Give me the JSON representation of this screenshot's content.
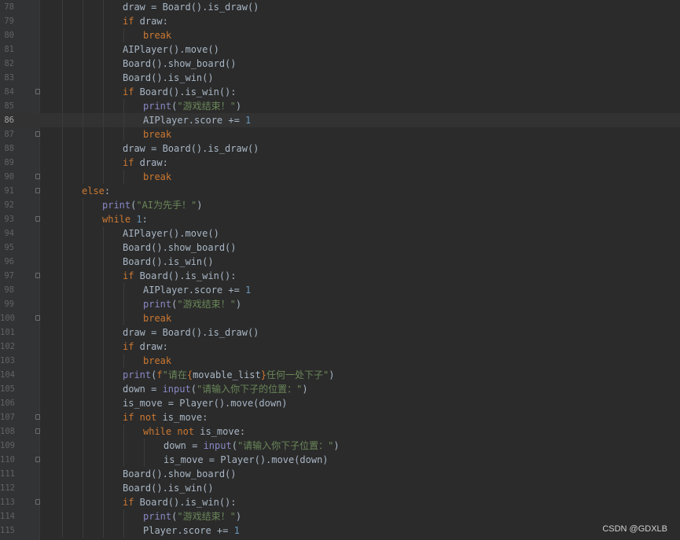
{
  "editor": {
    "current_line": 86,
    "lines": [
      {
        "n": "78",
        "indent": 4,
        "fold": false,
        "tokens": [
          {
            "t": "draw = Board().is_draw()",
            "c": "pl"
          }
        ]
      },
      {
        "n": "79",
        "indent": 4,
        "fold": false,
        "tokens": [
          {
            "t": "if",
            "c": "kw"
          },
          {
            "t": " draw:",
            "c": "pl"
          }
        ]
      },
      {
        "n": "80",
        "indent": 5,
        "fold": false,
        "tokens": [
          {
            "t": "break",
            "c": "kw"
          }
        ]
      },
      {
        "n": "81",
        "indent": 4,
        "fold": false,
        "tokens": [
          {
            "t": "AIPlayer().move()",
            "c": "pl"
          }
        ]
      },
      {
        "n": "82",
        "indent": 4,
        "fold": false,
        "tokens": [
          {
            "t": "Board().show_board()",
            "c": "pl"
          }
        ]
      },
      {
        "n": "83",
        "indent": 4,
        "fold": false,
        "tokens": [
          {
            "t": "Board().is_win()",
            "c": "pl"
          }
        ]
      },
      {
        "n": "84",
        "indent": 4,
        "fold": true,
        "tokens": [
          {
            "t": "if",
            "c": "kw"
          },
          {
            "t": " Board().is_win():",
            "c": "pl"
          }
        ]
      },
      {
        "n": "85",
        "indent": 5,
        "fold": false,
        "tokens": [
          {
            "t": "print",
            "c": "bi"
          },
          {
            "t": "(",
            "c": "pl"
          },
          {
            "t": "\"游戏结束！\"",
            "c": "str"
          },
          {
            "t": ")",
            "c": "pl"
          }
        ]
      },
      {
        "n": "86",
        "indent": 5,
        "fold": false,
        "tokens": [
          {
            "t": "AIPlayer.score += ",
            "c": "pl"
          },
          {
            "t": "1",
            "c": "num"
          }
        ]
      },
      {
        "n": "87",
        "indent": 5,
        "fold": true,
        "tokens": [
          {
            "t": "break",
            "c": "kw"
          }
        ]
      },
      {
        "n": "88",
        "indent": 4,
        "fold": false,
        "tokens": [
          {
            "t": "draw = Board().is_draw()",
            "c": "pl"
          }
        ]
      },
      {
        "n": "89",
        "indent": 4,
        "fold": false,
        "tokens": [
          {
            "t": "if",
            "c": "kw"
          },
          {
            "t": " draw:",
            "c": "pl"
          }
        ]
      },
      {
        "n": "90",
        "indent": 5,
        "fold": true,
        "tokens": [
          {
            "t": "break",
            "c": "kw"
          }
        ]
      },
      {
        "n": "91",
        "indent": 2,
        "fold": true,
        "tokens": [
          {
            "t": "else",
            "c": "kw"
          },
          {
            "t": ":",
            "c": "pl"
          }
        ]
      },
      {
        "n": "92",
        "indent": 3,
        "fold": false,
        "tokens": [
          {
            "t": "print",
            "c": "bi"
          },
          {
            "t": "(",
            "c": "pl"
          },
          {
            "t": "\"AI为先手！\"",
            "c": "str"
          },
          {
            "t": ")",
            "c": "pl"
          }
        ]
      },
      {
        "n": "93",
        "indent": 3,
        "fold": true,
        "tokens": [
          {
            "t": "while",
            "c": "kw"
          },
          {
            "t": " ",
            "c": "pl"
          },
          {
            "t": "1",
            "c": "num"
          },
          {
            "t": ":",
            "c": "pl"
          }
        ]
      },
      {
        "n": "94",
        "indent": 4,
        "fold": false,
        "tokens": [
          {
            "t": "AIPlayer().move()",
            "c": "pl"
          }
        ]
      },
      {
        "n": "95",
        "indent": 4,
        "fold": false,
        "tokens": [
          {
            "t": "Board().show_board()",
            "c": "pl"
          }
        ]
      },
      {
        "n": "96",
        "indent": 4,
        "fold": false,
        "tokens": [
          {
            "t": "Board().is_win()",
            "c": "pl"
          }
        ]
      },
      {
        "n": "97",
        "indent": 4,
        "fold": true,
        "tokens": [
          {
            "t": "if",
            "c": "kw"
          },
          {
            "t": " Board().is_win():",
            "c": "pl"
          }
        ]
      },
      {
        "n": "98",
        "indent": 5,
        "fold": false,
        "tokens": [
          {
            "t": "AIPlayer.score += ",
            "c": "pl"
          },
          {
            "t": "1",
            "c": "num"
          }
        ]
      },
      {
        "n": "99",
        "indent": 5,
        "fold": false,
        "tokens": [
          {
            "t": "print",
            "c": "bi"
          },
          {
            "t": "(",
            "c": "pl"
          },
          {
            "t": "\"游戏结束！\"",
            "c": "str"
          },
          {
            "t": ")",
            "c": "pl"
          }
        ]
      },
      {
        "n": "100",
        "indent": 5,
        "fold": true,
        "tokens": [
          {
            "t": "break",
            "c": "kw"
          }
        ]
      },
      {
        "n": "101",
        "indent": 4,
        "fold": false,
        "tokens": [
          {
            "t": "draw = Board().is_draw()",
            "c": "pl"
          }
        ]
      },
      {
        "n": "102",
        "indent": 4,
        "fold": false,
        "tokens": [
          {
            "t": "if",
            "c": "kw"
          },
          {
            "t": " draw:",
            "c": "pl"
          }
        ]
      },
      {
        "n": "103",
        "indent": 5,
        "fold": false,
        "tokens": [
          {
            "t": "break",
            "c": "kw"
          }
        ]
      },
      {
        "n": "104",
        "indent": 4,
        "fold": false,
        "tokens": [
          {
            "t": "print",
            "c": "bi"
          },
          {
            "t": "(",
            "c": "pl"
          },
          {
            "t": "f",
            "c": "fp"
          },
          {
            "t": "\"请在",
            "c": "str"
          },
          {
            "t": "{",
            "c": "fp"
          },
          {
            "t": "movable_list",
            "c": "pl"
          },
          {
            "t": "}",
            "c": "fp"
          },
          {
            "t": "任何一处下子\"",
            "c": "str"
          },
          {
            "t": ")",
            "c": "pl"
          }
        ]
      },
      {
        "n": "105",
        "indent": 4,
        "fold": false,
        "tokens": [
          {
            "t": "down = ",
            "c": "pl"
          },
          {
            "t": "input",
            "c": "bi"
          },
          {
            "t": "(",
            "c": "pl"
          },
          {
            "t": "\"请输入你下子的位置：\"",
            "c": "str"
          },
          {
            "t": ")",
            "c": "pl"
          }
        ]
      },
      {
        "n": "106",
        "indent": 4,
        "fold": false,
        "tokens": [
          {
            "t": "is_move = Player().move(down)",
            "c": "pl"
          }
        ]
      },
      {
        "n": "107",
        "indent": 4,
        "fold": true,
        "tokens": [
          {
            "t": "if not",
            "c": "kw"
          },
          {
            "t": " is_move:",
            "c": "pl"
          }
        ]
      },
      {
        "n": "108",
        "indent": 5,
        "fold": true,
        "tokens": [
          {
            "t": "while not",
            "c": "kw"
          },
          {
            "t": " is_move:",
            "c": "pl"
          }
        ]
      },
      {
        "n": "109",
        "indent": 6,
        "fold": false,
        "tokens": [
          {
            "t": "down = ",
            "c": "pl"
          },
          {
            "t": "input",
            "c": "bi"
          },
          {
            "t": "(",
            "c": "pl"
          },
          {
            "t": "\"请输入你下子位置：\"",
            "c": "str"
          },
          {
            "t": ")",
            "c": "pl"
          }
        ]
      },
      {
        "n": "110",
        "indent": 6,
        "fold": true,
        "tokens": [
          {
            "t": "is_move = Player().move(down)",
            "c": "pl"
          }
        ]
      },
      {
        "n": "111",
        "indent": 4,
        "fold": false,
        "tokens": [
          {
            "t": "Board().show_board()",
            "c": "pl"
          }
        ]
      },
      {
        "n": "112",
        "indent": 4,
        "fold": false,
        "tokens": [
          {
            "t": "Board().is_win()",
            "c": "pl"
          }
        ]
      },
      {
        "n": "113",
        "indent": 4,
        "fold": true,
        "tokens": [
          {
            "t": "if",
            "c": "kw"
          },
          {
            "t": " Board().is_win():",
            "c": "pl"
          }
        ]
      },
      {
        "n": "114",
        "indent": 5,
        "fold": false,
        "tokens": [
          {
            "t": "print",
            "c": "bi"
          },
          {
            "t": "(",
            "c": "pl"
          },
          {
            "t": "\"游戏结束！\"",
            "c": "str"
          },
          {
            "t": ")",
            "c": "pl"
          }
        ]
      },
      {
        "n": "115",
        "indent": 5,
        "fold": false,
        "tokens": [
          {
            "t": "Player.score += ",
            "c": "pl"
          },
          {
            "t": "1",
            "c": "num"
          }
        ]
      }
    ]
  },
  "watermark": "CSDN @GDXLB"
}
